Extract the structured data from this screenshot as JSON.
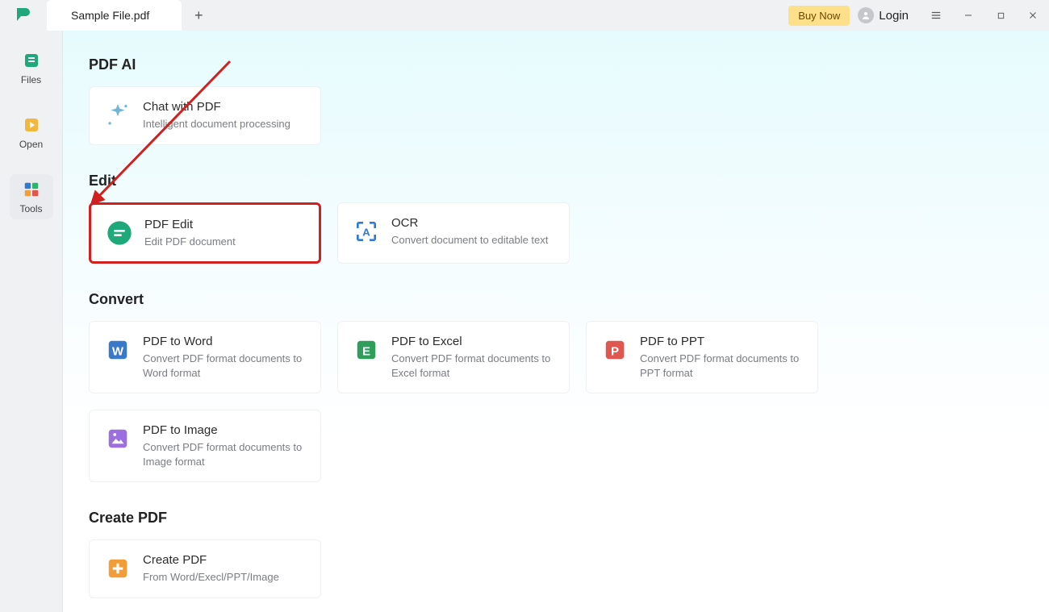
{
  "titlebar": {
    "tab_title": "Sample File.pdf",
    "buy_now": "Buy Now",
    "login": "Login"
  },
  "sidebar": {
    "files": "Files",
    "open": "Open",
    "tools": "Tools"
  },
  "sections": {
    "pdf_ai": {
      "heading": "PDF AI",
      "chat": {
        "title": "Chat with PDF",
        "desc": "Intelligent document processing"
      }
    },
    "edit": {
      "heading": "Edit",
      "pdf_edit": {
        "title": "PDF Edit",
        "desc": "Edit PDF document"
      },
      "ocr": {
        "title": "OCR",
        "desc": "Convert document to editable text"
      }
    },
    "convert": {
      "heading": "Convert",
      "to_word": {
        "title": "PDF to Word",
        "desc": "Convert PDF format documents to Word format"
      },
      "to_excel": {
        "title": "PDF to Excel",
        "desc": "Convert PDF format documents to Excel format"
      },
      "to_ppt": {
        "title": "PDF to PPT",
        "desc": "Convert PDF format documents to PPT format"
      },
      "to_image": {
        "title": "PDF to Image",
        "desc": "Convert PDF format documents to Image format"
      }
    },
    "create": {
      "heading": "Create PDF",
      "create": {
        "title": "Create PDF",
        "desc": "From Word/Execl/PPT/Image"
      }
    }
  }
}
